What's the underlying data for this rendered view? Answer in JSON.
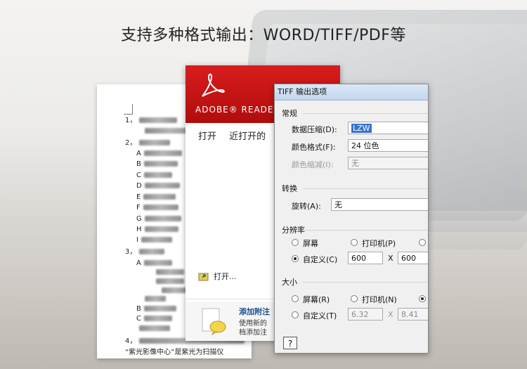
{
  "headline": "支持多种格式输出：WORD/TIFF/PDF等",
  "doc": {
    "lines": [
      {
        "text": "1，",
        "blur": 54
      },
      {
        "text": "",
        "blur": 72
      },
      {
        "text": "2，",
        "blur": 44
      },
      {
        "text": "A",
        "blur": 54
      },
      {
        "text": "B",
        "blur": 48
      },
      {
        "text": "C",
        "blur": 40
      },
      {
        "text": "D",
        "blur": 50
      },
      {
        "text": "E",
        "blur": 46
      },
      {
        "text": "F",
        "blur": 50
      },
      {
        "text": "G",
        "blur": 52
      },
      {
        "text": "H",
        "blur": 48
      },
      {
        "text": "I",
        "blur": 44
      },
      {
        "text": "3，",
        "blur": 36
      },
      {
        "text": "A",
        "blur": 40
      },
      {
        "text": "",
        "blur": 40
      },
      {
        "text": "",
        "blur": 40
      },
      {
        "text": "",
        "blur": 38
      },
      {
        "text": "",
        "blur": 30
      },
      {
        "text": "B",
        "blur": 46
      },
      {
        "text": "C",
        "blur": 40
      },
      {
        "text": "",
        "blur": 44
      },
      {
        "text": "4，",
        "blur": 150
      }
    ],
    "last_line": "“紫光影像中心”是紫光为扫描仪"
  },
  "adobe": {
    "title": "ADOBE® READER",
    "tab_open": "打开",
    "tab_recent": "近打开的",
    "open_link": "打开...",
    "promo_title": "添加附注",
    "promo_line1": "使用新的",
    "promo_line2": "档添加注"
  },
  "dialog": {
    "title": "TIFF 输出选项",
    "general": {
      "heading": "常规",
      "compression_label": "数据压缩(D):",
      "compression_value": "LZW",
      "color_label": "颜色格式(F):",
      "color_value": "24 位色",
      "reduce_label": "颜色缩减(I):",
      "reduce_value": "无"
    },
    "convert": {
      "heading": "转换",
      "rotate_label": "旋转(A):",
      "rotate_value": "无"
    },
    "resolution": {
      "heading": "分辨率",
      "screen": "屏幕",
      "printer": "打印机(P)",
      "custom": "自定义(C)",
      "x_value": "600",
      "times": "X",
      "y_value": "600",
      "selected": "custom"
    },
    "size": {
      "heading": "大小",
      "screen": "屏幕(R)",
      "printer": "打印机(N)",
      "custom": "自定义(T)",
      "w_value": "6.32",
      "times": "X",
      "h_value": "8.41",
      "selected": "third"
    },
    "help": "?"
  }
}
